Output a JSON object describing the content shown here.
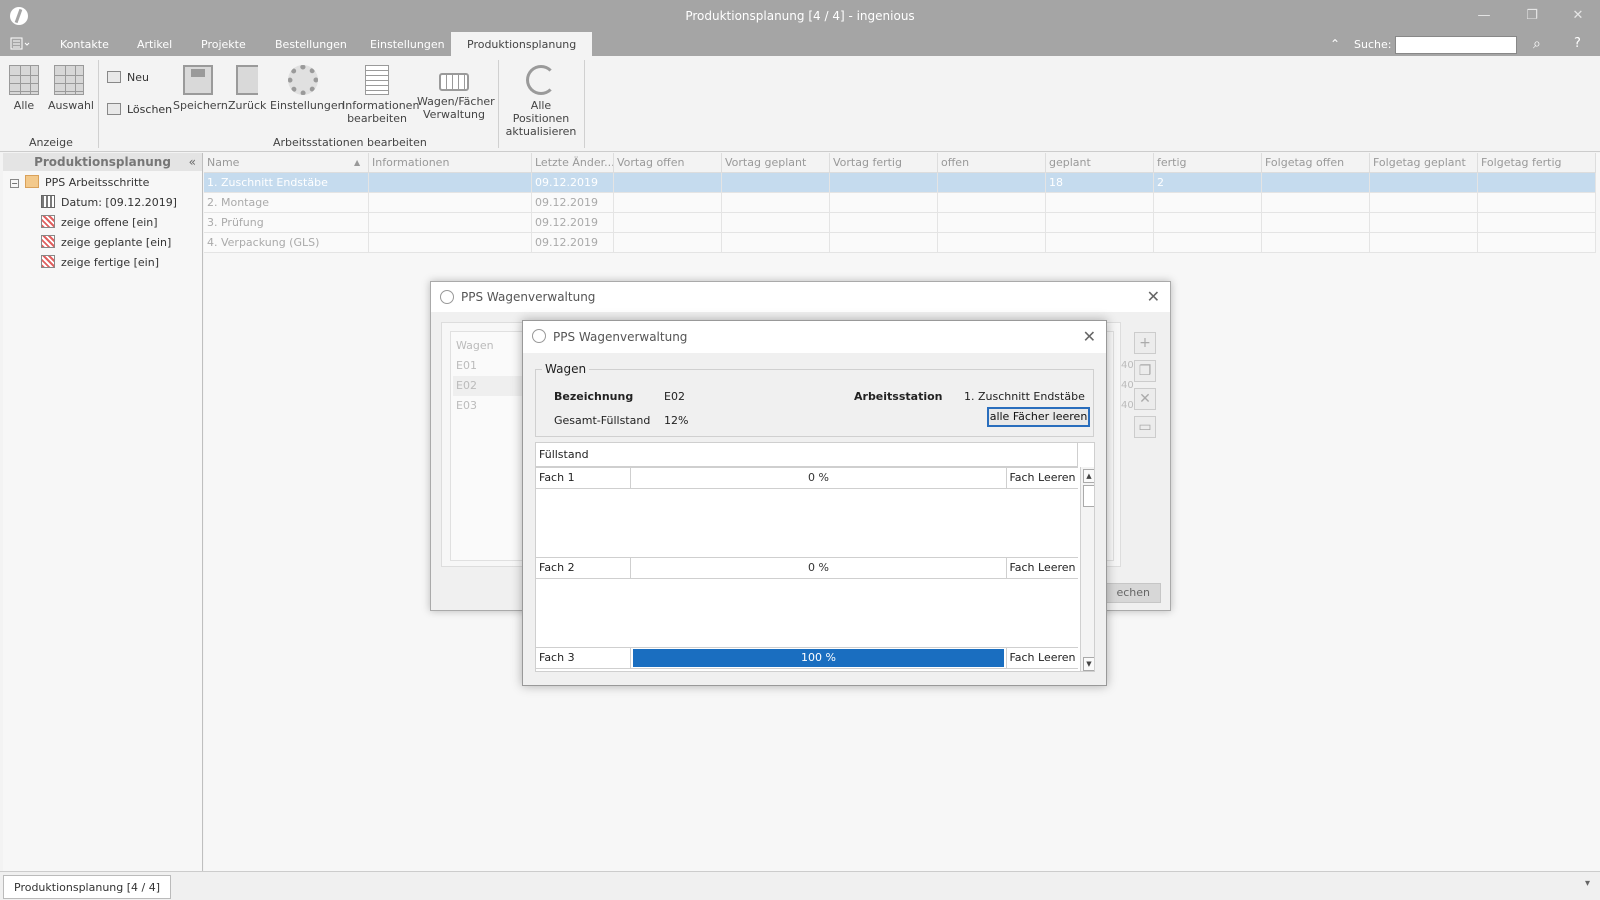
{
  "window": {
    "title": "Produktionsplanung [4 / 4] - ingenious",
    "minimize": "—",
    "restore": "❐",
    "close": "✕"
  },
  "menu": {
    "tabs": [
      "Kontakte",
      "Artikel",
      "Projekte",
      "Bestellungen",
      "Einstellungen",
      "Produktionsplanung"
    ],
    "active_tab": "Produktionsplanung",
    "search_label": "Suche:",
    "search_value": ""
  },
  "ribbon": {
    "anzeige": {
      "alle": "Alle",
      "auswahl": "Auswahl",
      "group": "Anzeige"
    },
    "edit": {
      "neu": "Neu",
      "loeschen": "Löschen",
      "speichern": "Speichern",
      "zurueck": "Zurück",
      "einstellungen": "Einstellungen",
      "informationen_1": "Informationen",
      "informationen_2": "bearbeiten",
      "wagen_1": "Wagen/Fächer",
      "wagen_2": "Verwaltung",
      "alle_pos_1": "Alle Positionen",
      "alle_pos_2": "aktualisieren",
      "group": "Arbeitsstationen bearbeiten"
    }
  },
  "sidebar": {
    "header": "Produktionsplanung",
    "collapse_icon": "«",
    "root": "PPS Arbeitsschritte",
    "items": [
      "Datum: [09.12.2019]",
      "zeige offene [ein]",
      "zeige geplante [ein]",
      "zeige fertige [ein]"
    ]
  },
  "grid": {
    "columns": [
      "Name",
      "Informationen",
      "Letzte Änder...",
      "Vortag offen",
      "Vortag geplant",
      "Vortag fertig",
      "offen",
      "geplant",
      "fertig",
      "Folgetag offen",
      "Folgetag geplant",
      "Folgetag fertig"
    ],
    "rows": [
      {
        "name": "1. Zuschnitt Endstäbe",
        "info": "",
        "date": "09.12.2019",
        "vo": "",
        "vg": "",
        "vf": "",
        "o": "",
        "g": "18",
        "f": "2",
        "fo": "",
        "fg": "",
        "ff": ""
      },
      {
        "name": "2. Montage",
        "info": "",
        "date": "09.12.2019",
        "vo": "",
        "vg": "",
        "vf": "",
        "o": "",
        "g": "",
        "f": "",
        "fo": "",
        "fg": "",
        "ff": ""
      },
      {
        "name": "3. Prüfung",
        "info": "",
        "date": "09.12.2019",
        "vo": "",
        "vg": "",
        "vf": "",
        "o": "",
        "g": "",
        "f": "",
        "fo": "",
        "fg": "",
        "ff": ""
      },
      {
        "name": "4. Verpackung (GLS)",
        "info": "",
        "date": "09.12.2019",
        "vo": "",
        "vg": "",
        "vf": "",
        "o": "",
        "g": "",
        "f": "",
        "fo": "",
        "fg": "",
        "ff": ""
      }
    ]
  },
  "bg_dialog": {
    "title": "PPS Wagenverwaltung",
    "header": "Wagen",
    "rows": [
      "E01",
      "E02",
      "E03"
    ],
    "values": [
      "40",
      "40",
      "40"
    ],
    "cancel": "echen"
  },
  "fg_dialog": {
    "title": "PPS Wagenverwaltung",
    "group_label": "Wagen",
    "bezeichnung_label": "Bezeichnung",
    "bezeichnung_value": "E02",
    "arbeitsstation_label": "Arbeitsstation",
    "arbeitsstation_value": "1. Zuschnitt Endstäbe",
    "fuellstand_label": "Gesamt-Füllstand",
    "fuellstand_value": "12%",
    "clear_all": "alle Fächer leeren",
    "list_header": "Füllstand",
    "faecher": [
      {
        "name": "Fach 1",
        "level": 0,
        "text": "0 %",
        "button": "Fach Leeren"
      },
      {
        "name": "Fach 2",
        "level": 0,
        "text": "0 %",
        "button": "Fach Leeren"
      },
      {
        "name": "Fach 3",
        "level": 100,
        "text": "100 %",
        "button": "Fach Leeren"
      }
    ],
    "bar_color": "#1a6ec0"
  },
  "status": {
    "tab": "Produktionsplanung [4 / 4]",
    "dropdown": "▾"
  }
}
